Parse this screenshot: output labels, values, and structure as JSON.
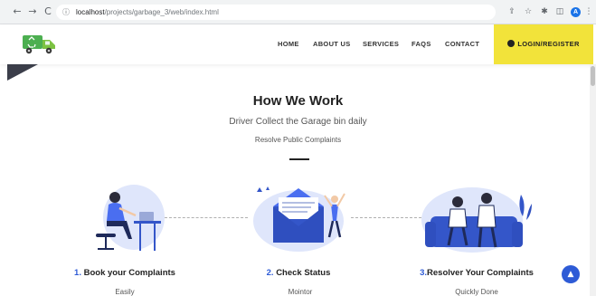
{
  "browser": {
    "url_host": "localhost",
    "url_path": "/projects/garbage_3/web/index.html",
    "back_icon": "←",
    "forward_icon": "→",
    "reload_icon": "C",
    "info_icon": "ⓘ",
    "share_icon": "⇪",
    "star_icon": "☆",
    "extensions_icon": "✱",
    "sidebar_icon": "◫",
    "menu_icon": "⋮",
    "profile_initial": "A"
  },
  "header": {
    "nav": [
      "HOME",
      "ABOUT US",
      "SERVICES",
      "FAQS",
      "CONTACT"
    ],
    "login_label": "LOGIN/REGISTER"
  },
  "section": {
    "title": "How We Work",
    "subtitle": "Driver Collect the Garage bin daily",
    "tagline": "Resolve Public Complaints"
  },
  "steps": [
    {
      "num": "1.",
      "title": "Book your Complaints",
      "desc": "Easily"
    },
    {
      "num": "2.",
      "title": "Check Status",
      "desc": "Mointor"
    },
    {
      "num": "3.",
      "title": "Resolver Your Complaints",
      "desc": "Quickly Done"
    }
  ],
  "back_to_top_icon": "▲",
  "colors": {
    "accent": "#2e5bd6",
    "login_bg": "#f2e33a",
    "logo_green": "#4caf50"
  }
}
